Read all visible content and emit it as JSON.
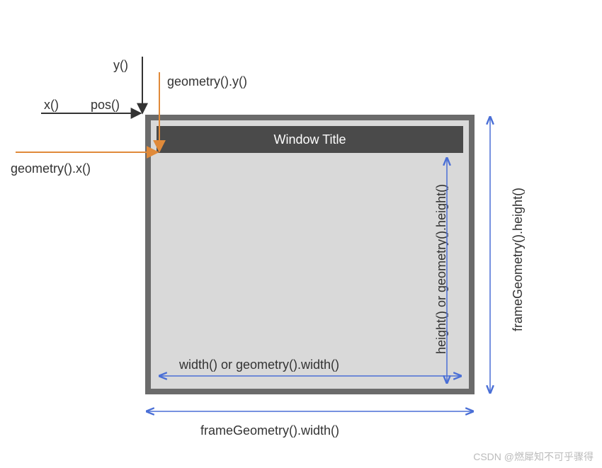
{
  "labels": {
    "y": "y()",
    "geometry_y": "geometry().y()",
    "x": "x()",
    "pos": "pos()",
    "geometry_x": "geometry().x()",
    "window_title": "Window Title",
    "width": "width() or geometry().width()",
    "height": "height() or geometry().height()",
    "frame_width": "frameGeometry().width()",
    "frame_height": "frameGeometry().height()"
  },
  "watermark": "CSDN @燃犀知不可乎骤得"
}
